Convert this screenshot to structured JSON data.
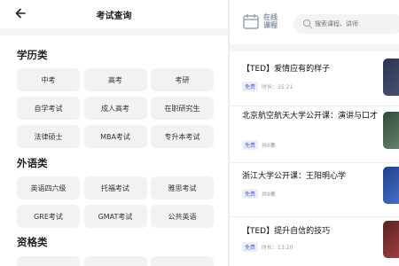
{
  "left": {
    "title": "考试查询",
    "sections": [
      {
        "title": "学历类",
        "items": [
          "中考",
          "高考",
          "考研",
          "自学考试",
          "成人高考",
          "在职研究生",
          "法律硕士",
          "MBA考试",
          "专升本考试"
        ]
      },
      {
        "title": "外语类",
        "items": [
          "英语四六级",
          "托福考试",
          "雅思考试",
          "GRE考试",
          "GMAT考试",
          "公共英语"
        ]
      },
      {
        "title": "资格类",
        "items": []
      }
    ]
  },
  "right": {
    "brand_line1": "在线",
    "brand_line2": "课程",
    "search_placeholder": "搜索课程、讲师",
    "courses": [
      {
        "title": "【TED】爱情应有的样子",
        "badge": "免费",
        "meta": "时长：15:21"
      },
      {
        "title": "北京航空航天大学公开课：演讲与口才",
        "badge": "免费",
        "meta": "共6集"
      },
      {
        "title": "浙江大学公开课：王阳明心学",
        "badge": "免费",
        "meta": "共9集"
      },
      {
        "title": "【TED】提升自信的技巧",
        "badge": "免费",
        "meta": "时长：13:20"
      }
    ]
  },
  "colors": {
    "accent": "#5a6bd8",
    "chip_bg": "#f2f2f2",
    "page_bg": "#ececec"
  }
}
